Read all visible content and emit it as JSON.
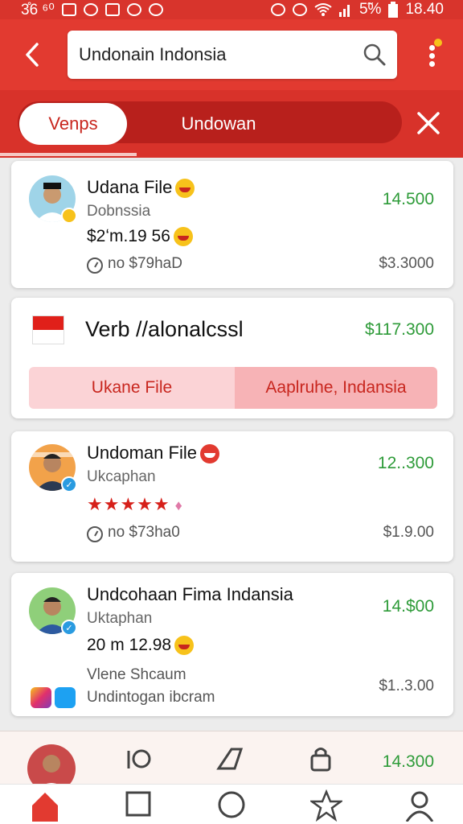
{
  "status_bar": {
    "left_text": "3̊6 ⁶⁰",
    "battery": "5̃%",
    "time": "18.40"
  },
  "header": {
    "search_value": "Undonain Indonsia",
    "search_icon": "search-icon",
    "back_icon": "chevron-left-icon",
    "more_icon": "more-vertical-icon"
  },
  "tabs": {
    "active_label": "Venps",
    "inactive_label": "Undowan",
    "close_icon": "close-icon"
  },
  "colors": {
    "brand_red": "#e23a30",
    "price_green": "#2e9b39",
    "star_red": "#d6201a"
  },
  "cards": [
    {
      "title": "Udana File",
      "subtitle": "Dobnssia",
      "line": "$2ʻm.19 56",
      "meta": "no $79haD",
      "price": "14.500",
      "secondary": "$3.3000"
    },
    {
      "title": "Verb //alonalcssl",
      "price": "$117.300",
      "button_left": "Ukane File",
      "button_right": "Aaplruhe, Indansia"
    },
    {
      "title": "Undoman File",
      "subtitle": "Ukcaphan",
      "rating": "★★★★★",
      "rating_extra": "♦",
      "meta": "no $73ha0",
      "price": "12..300",
      "secondary": "$1.9.00"
    },
    {
      "title": "Undcohaan Fima Indansia",
      "subtitle": "Uktaphan",
      "line": "20 m 12.98",
      "meta_line1": "Vlene Shcaum",
      "meta_line2": "Undintogan ibcram",
      "price": "14.$00",
      "secondary": "$1..3.00"
    }
  ],
  "bottom_strip": {
    "price": "14.300"
  },
  "bottom_nav": {
    "items": [
      "home-icon",
      "square-icon",
      "circle-icon",
      "star-icon",
      "profile-icon"
    ]
  }
}
